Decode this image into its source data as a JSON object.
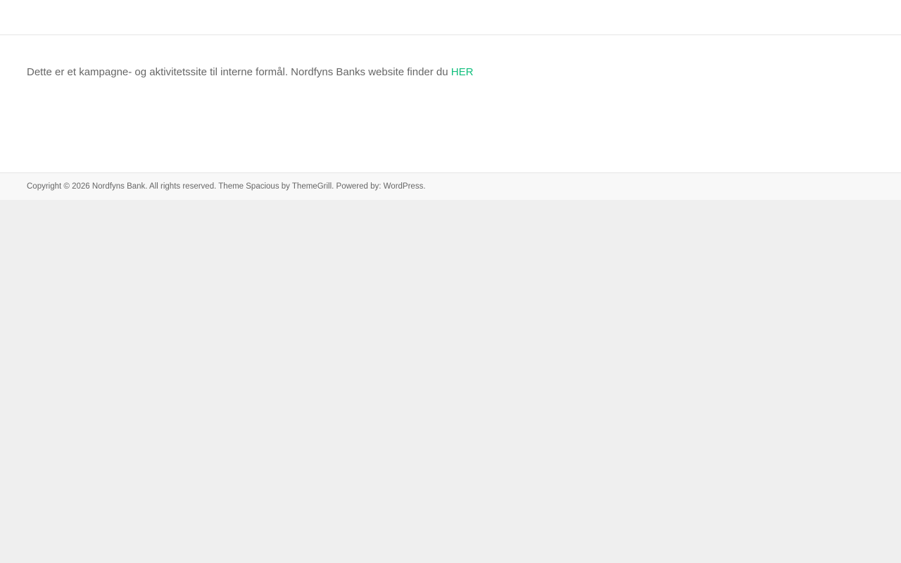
{
  "main": {
    "notice_text": "Dette er et kampagne- og aktivitetssite til interne formål. Nordfyns Banks website finder du ",
    "notice_link": "HER"
  },
  "footer": {
    "copyright_prefix": "Copyright © 2026 ",
    "site_link": "Nordfyns Bank",
    "rights_text": ". All rights reserved. Theme ",
    "theme_link": "Spacious",
    "by_text": " by ",
    "author_link": "ThemeGrill",
    "powered_text": ". Powered by: ",
    "wordpress_link": "WordPress",
    "end_text": "."
  },
  "colors": {
    "link_accent": "#0fbe7c",
    "text": "#666666",
    "page_background": "#efefef",
    "footer_background": "#f8f8f8"
  }
}
